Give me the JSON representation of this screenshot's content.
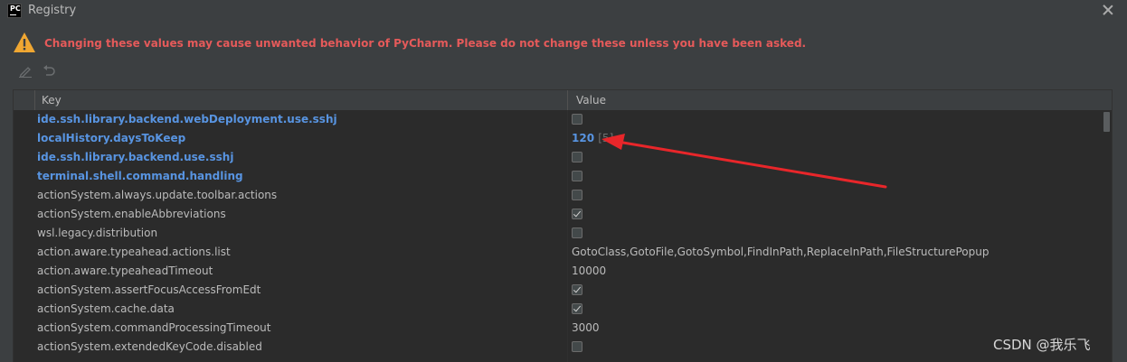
{
  "window": {
    "title": "Registry",
    "app_icon_text": "PC"
  },
  "warning": "Changing these values may cause unwanted behavior of PyCharm. Please do not change these unless you have been asked.",
  "columns": {
    "key": "Key",
    "value": "Value"
  },
  "rows": [
    {
      "key": "ide.ssh.library.backend.webDeployment.use.sshj",
      "type": "checkbox",
      "checked": false,
      "changed": true
    },
    {
      "key": "localHistory.daysToKeep",
      "type": "text",
      "value": "120",
      "default": "[5]",
      "changed": true
    },
    {
      "key": "ide.ssh.library.backend.use.sshj",
      "type": "checkbox",
      "checked": false,
      "changed": true
    },
    {
      "key": "terminal.shell.command.handling",
      "type": "checkbox",
      "checked": false,
      "changed": true
    },
    {
      "key": "actionSystem.always.update.toolbar.actions",
      "type": "checkbox",
      "checked": false,
      "changed": false
    },
    {
      "key": "actionSystem.enableAbbreviations",
      "type": "checkbox",
      "checked": true,
      "changed": false
    },
    {
      "key": "wsl.legacy.distribution",
      "type": "checkbox",
      "checked": false,
      "changed": false
    },
    {
      "key": "action.aware.typeahead.actions.list",
      "type": "text",
      "value": "GotoClass,GotoFile,GotoSymbol,FindInPath,ReplaceInPath,FileStructurePopup",
      "changed": false
    },
    {
      "key": "action.aware.typeaheadTimeout",
      "type": "text",
      "value": "10000",
      "changed": false
    },
    {
      "key": "actionSystem.assertFocusAccessFromEdt",
      "type": "checkbox",
      "checked": true,
      "changed": false
    },
    {
      "key": "actionSystem.cache.data",
      "type": "checkbox",
      "checked": true,
      "changed": false
    },
    {
      "key": "actionSystem.commandProcessingTimeout",
      "type": "text",
      "value": "3000",
      "changed": false
    },
    {
      "key": "actionSystem.extendedKeyCode.disabled",
      "type": "checkbox",
      "checked": false,
      "changed": false
    }
  ],
  "watermark": "CSDN @我乐飞",
  "colors": {
    "background": "#3c3f41",
    "table": "#2b2b2b",
    "changed": "#5894e1",
    "warning": "#e55a5a",
    "annotation_arrow": "#e8262a"
  },
  "icons": [
    "pycharm-app-icon",
    "close-icon",
    "warning-icon",
    "edit-icon",
    "undo-icon"
  ]
}
